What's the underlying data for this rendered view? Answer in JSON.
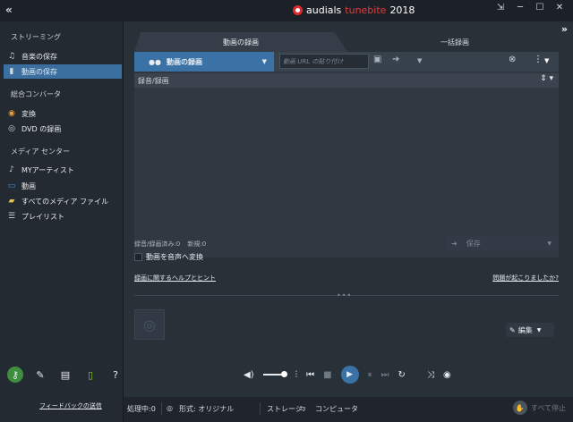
{
  "app": {
    "brand_name": "audials",
    "brand_product": "tunebite",
    "brand_year": "2018"
  },
  "window_controls": {
    "collapse_glyph": "«",
    "expand_glyph": "»",
    "icons": [
      "restore-icon",
      "minimize-icon",
      "maximize-icon",
      "close-icon"
    ]
  },
  "sidebar": {
    "section_streaming": "ストリーミング",
    "item_music": "音楽の保存",
    "item_video": "動画の保存",
    "section_converter": "総合コンバータ",
    "item_convert": "変換",
    "item_dvd": "DVD の録画",
    "section_media": "メディア センター",
    "item_artist": "MYアーティスト",
    "item_movie": "動画",
    "item_allfiles": "すべてのメディア ファイル",
    "item_playlist": "プレイリスト",
    "feedback": "フィードバックの送信"
  },
  "tabs": {
    "video_record": "動画の録画",
    "bulk_record": "一括録画"
  },
  "toolbar": {
    "mode_label": "動画の録画",
    "url_placeholder": "動画 URL の貼り付け"
  },
  "list": {
    "header": "録音/録画"
  },
  "status": {
    "recorded": "録音/録画済み:0",
    "new": "新規:0",
    "save_label": "保存",
    "convert_audio": "動画を音声へ変換",
    "help_link": "録画に関するヘルプとヒント",
    "problem_link": "問題が起こりましたか?",
    "edit_label": "編集"
  },
  "player": {
    "volume_fraction": 0.9
  },
  "statusbar": {
    "processing": "処理中:0",
    "format": "形式: オリジナル",
    "storage": "ストレージ:",
    "computer": "コンピュータ",
    "stop_all": "すべて停止"
  },
  "colors": {
    "accent": "#3b72a6",
    "brand_red": "#e43b3b",
    "sidebar_active": "#3a6fa0"
  }
}
